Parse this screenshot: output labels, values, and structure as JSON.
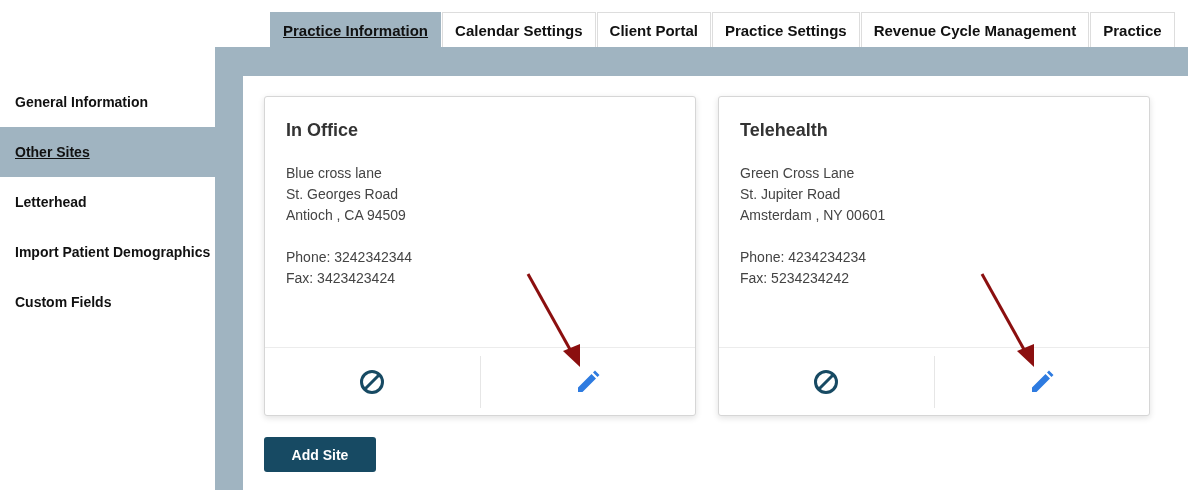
{
  "tabs": [
    {
      "label": "Practice Information",
      "selected": true
    },
    {
      "label": "Calendar Settings",
      "selected": false
    },
    {
      "label": "Client Portal",
      "selected": false
    },
    {
      "label": "Practice Settings",
      "selected": false
    },
    {
      "label": "Revenue Cycle Management",
      "selected": false
    },
    {
      "label": "Practice",
      "selected": false
    }
  ],
  "sidebar": {
    "items": [
      {
        "label": "General Information",
        "selected": false
      },
      {
        "label": "Other Sites",
        "selected": true
      },
      {
        "label": "Letterhead",
        "selected": false
      },
      {
        "label": "Import Patient Demographics",
        "selected": false
      },
      {
        "label": "Custom Fields",
        "selected": false
      }
    ]
  },
  "sites": [
    {
      "name": "In Office",
      "address_lines": [
        "Blue cross lane",
        "St. Georges Road",
        "Antioch , CA 94509"
      ],
      "phone": "Phone: 3242342344",
      "fax": "Fax: 3423423424",
      "annotated": true
    },
    {
      "name": "Telehealth",
      "address_lines": [
        "Green Cross Lane",
        "St. Jupiter Road",
        "Amsterdam , NY 00601"
      ],
      "phone": "Phone: 4234234234",
      "fax": "Fax: 5234234242",
      "annotated": true
    }
  ],
  "add_button": "Add Site"
}
